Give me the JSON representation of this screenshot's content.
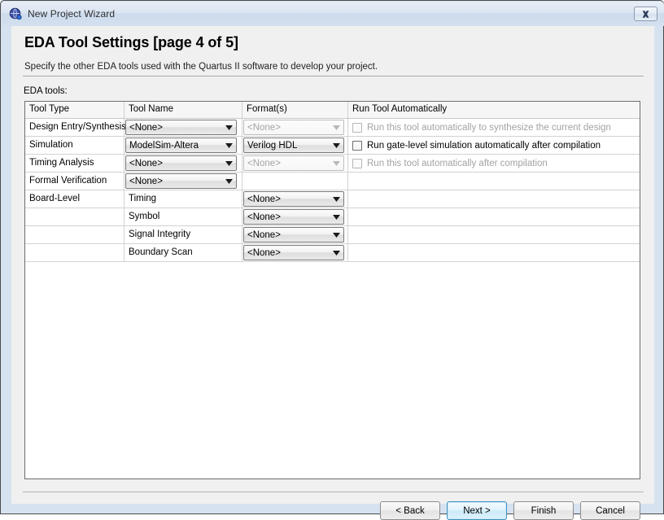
{
  "window": {
    "title": "New Project Wizard",
    "icon": "quartus-globe-icon",
    "close_label": "Close"
  },
  "page": {
    "title": "EDA Tool Settings [page 4 of 5]",
    "subtitle": "Specify the other EDA tools used with the Quartus II software to develop your project.",
    "section_label": "EDA tools:"
  },
  "table": {
    "columns": [
      "Tool Type",
      "Tool Name",
      "Format(s)",
      "Run Tool Automatically"
    ],
    "rows": [
      {
        "tool_type": "Design Entry/Synthesis",
        "tool_name": {
          "value": "<None>",
          "enabled": true
        },
        "format": {
          "value": "<None>",
          "enabled": false
        },
        "run_auto": {
          "label": "Run this tool automatically to synthesize the current design",
          "enabled": false,
          "checked": false,
          "has_checkbox": true
        }
      },
      {
        "tool_type": "Simulation",
        "tool_name": {
          "value": "ModelSim-Altera",
          "enabled": true
        },
        "format": {
          "value": "Verilog HDL",
          "enabled": true
        },
        "run_auto": {
          "label": "Run gate-level simulation automatically after compilation",
          "enabled": true,
          "checked": false,
          "has_checkbox": true
        }
      },
      {
        "tool_type": "Timing Analysis",
        "tool_name": {
          "value": "<None>",
          "enabled": true
        },
        "format": {
          "value": "<None>",
          "enabled": false
        },
        "run_auto": {
          "label": "Run this tool automatically after compilation",
          "enabled": false,
          "checked": false,
          "has_checkbox": true
        }
      },
      {
        "tool_type": "Formal Verification",
        "tool_name": {
          "value": "<None>",
          "enabled": true
        },
        "format": null,
        "run_auto": null
      },
      {
        "tool_type": "Board-Level",
        "tool_name": {
          "value": "Timing",
          "enabled": false,
          "plain": true
        },
        "format": {
          "value": "<None>",
          "enabled": true
        },
        "run_auto": null
      },
      {
        "tool_type": "",
        "tool_name": {
          "value": "Symbol",
          "enabled": false,
          "plain": true
        },
        "format": {
          "value": "<None>",
          "enabled": true
        },
        "run_auto": null
      },
      {
        "tool_type": "",
        "tool_name": {
          "value": "Signal Integrity",
          "enabled": false,
          "plain": true
        },
        "format": {
          "value": "<None>",
          "enabled": true
        },
        "run_auto": null
      },
      {
        "tool_type": "",
        "tool_name": {
          "value": "Boundary Scan",
          "enabled": false,
          "plain": true
        },
        "format": {
          "value": "<None>",
          "enabled": true
        },
        "run_auto": null
      }
    ]
  },
  "buttons": [
    {
      "label": "< Back",
      "name": "back-button",
      "default": false
    },
    {
      "label": "Next >",
      "name": "next-button",
      "default": true
    },
    {
      "label": "Finish",
      "name": "finish-button",
      "default": false
    },
    {
      "label": "Cancel",
      "name": "cancel-button",
      "default": false
    }
  ],
  "colors": {
    "titlebar": "#dbe5f2",
    "window_frame": "#d6e2f0",
    "content_bg": "#f0f0f0",
    "table_bg": "#ffffff",
    "default_button_accent": "#3c93c2",
    "disabled_text": "#a3a3a3"
  }
}
